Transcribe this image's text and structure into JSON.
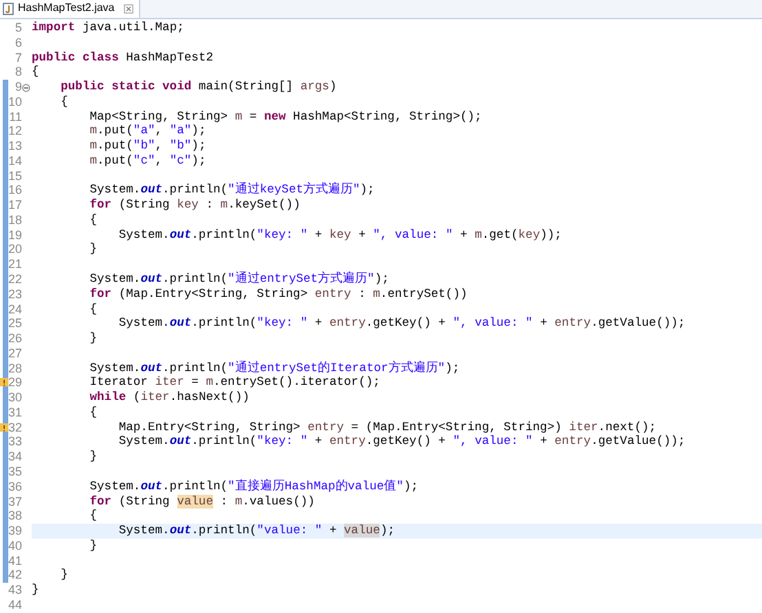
{
  "tab": {
    "title": "HashMapTest2.java",
    "selected": true
  },
  "lines": [
    {
      "number": "5",
      "in_scope": false,
      "current": false,
      "kind": "plain",
      "tokens": [
        {
          "kind": "keyword",
          "text": "import"
        },
        {
          "kind": "plain",
          "text": " java.util.Map;"
        }
      ]
    },
    {
      "number": "6",
      "in_scope": false,
      "current": false,
      "kind": "plain"
    },
    {
      "number": "7",
      "in_scope": false,
      "current": false,
      "kind": "plain",
      "tokens": [
        {
          "kind": "keyword",
          "text": "public "
        },
        {
          "kind": "keyword",
          "text": "class"
        },
        {
          "kind": "plain",
          "text": " HashMapTest2"
        }
      ]
    },
    {
      "number": "8",
      "in_scope": false,
      "current": false,
      "kind": "plain",
      "tokens": [
        {
          "kind": "plain",
          "text": "{"
        }
      ]
    },
    {
      "number": "9",
      "in_scope": true,
      "current": false,
      "kind": "fold",
      "tokens": [
        {
          "kind": "keyword",
          "text": "    public "
        },
        {
          "kind": "keyword",
          "text": "static "
        },
        {
          "kind": "keyword",
          "text": "void"
        },
        {
          "kind": "plain",
          "text": " main(String[] "
        },
        {
          "kind": "variable",
          "text": "args"
        },
        {
          "kind": "plain",
          "text": ")"
        }
      ]
    },
    {
      "number": "10",
      "in_scope": true,
      "current": false,
      "kind": "plain",
      "tokens": [
        {
          "kind": "plain",
          "text": "    {"
        }
      ]
    },
    {
      "number": "11",
      "in_scope": true,
      "current": false,
      "kind": "plain",
      "tokens": [
        {
          "kind": "plain",
          "text": "        Map<String, String> "
        },
        {
          "kind": "variable",
          "text": "m"
        },
        {
          "kind": "plain",
          "text": " = "
        },
        {
          "kind": "keyword",
          "text": "new"
        },
        {
          "kind": "plain",
          "text": " HashMap<String, String>();"
        }
      ]
    },
    {
      "number": "12",
      "in_scope": true,
      "current": false,
      "kind": "plain",
      "tokens": [
        {
          "kind": "variable",
          "text": "        m"
        },
        {
          "kind": "plain",
          "text": ".put("
        },
        {
          "kind": "string",
          "text": "\"a\""
        },
        {
          "kind": "plain",
          "text": ", "
        },
        {
          "kind": "string",
          "text": "\"a\""
        },
        {
          "kind": "plain",
          "text": ");"
        }
      ]
    },
    {
      "number": "13",
      "in_scope": true,
      "current": false,
      "kind": "plain",
      "tokens": [
        {
          "kind": "variable",
          "text": "        m"
        },
        {
          "kind": "plain",
          "text": ".put("
        },
        {
          "kind": "string",
          "text": "\"b\""
        },
        {
          "kind": "plain",
          "text": ", "
        },
        {
          "kind": "string",
          "text": "\"b\""
        },
        {
          "kind": "plain",
          "text": ");"
        }
      ]
    },
    {
      "number": "14",
      "in_scope": true,
      "current": false,
      "kind": "plain",
      "tokens": [
        {
          "kind": "variable",
          "text": "        m"
        },
        {
          "kind": "plain",
          "text": ".put("
        },
        {
          "kind": "string",
          "text": "\"c\""
        },
        {
          "kind": "plain",
          "text": ", "
        },
        {
          "kind": "string",
          "text": "\"c\""
        },
        {
          "kind": "plain",
          "text": ");"
        }
      ]
    },
    {
      "number": "15",
      "in_scope": true,
      "current": false,
      "kind": "plain"
    },
    {
      "number": "16",
      "in_scope": true,
      "current": false,
      "kind": "plain",
      "tokens": [
        {
          "kind": "plain",
          "text": "        System."
        },
        {
          "kind": "field",
          "text": "out"
        },
        {
          "kind": "plain",
          "text": ".println("
        },
        {
          "kind": "string",
          "text": "\"通过keySet方式遍历\""
        },
        {
          "kind": "plain",
          "text": ");"
        }
      ]
    },
    {
      "number": "17",
      "in_scope": true,
      "current": false,
      "kind": "plain",
      "tokens": [
        {
          "kind": "keyword",
          "text": "        for"
        },
        {
          "kind": "plain",
          "text": " (String "
        },
        {
          "kind": "variable",
          "text": "key"
        },
        {
          "kind": "plain",
          "text": " : "
        },
        {
          "kind": "variable",
          "text": "m"
        },
        {
          "kind": "plain",
          "text": ".keySet())"
        }
      ]
    },
    {
      "number": "18",
      "in_scope": true,
      "current": false,
      "kind": "plain",
      "tokens": [
        {
          "kind": "plain",
          "text": "        {"
        }
      ]
    },
    {
      "number": "19",
      "in_scope": true,
      "current": false,
      "kind": "plain",
      "tokens": [
        {
          "kind": "plain",
          "text": "            System."
        },
        {
          "kind": "field",
          "text": "out"
        },
        {
          "kind": "plain",
          "text": ".println("
        },
        {
          "kind": "string",
          "text": "\"key: \""
        },
        {
          "kind": "plain",
          "text": " + "
        },
        {
          "kind": "variable",
          "text": "key"
        },
        {
          "kind": "plain",
          "text": " + "
        },
        {
          "kind": "string",
          "text": "\", value: \""
        },
        {
          "kind": "plain",
          "text": " + "
        },
        {
          "kind": "variable",
          "text": "m"
        },
        {
          "kind": "plain",
          "text": ".get("
        },
        {
          "kind": "variable",
          "text": "key"
        },
        {
          "kind": "plain",
          "text": "));"
        }
      ]
    },
    {
      "number": "20",
      "in_scope": true,
      "current": false,
      "kind": "plain",
      "tokens": [
        {
          "kind": "plain",
          "text": "        }"
        }
      ]
    },
    {
      "number": "21",
      "in_scope": true,
      "current": false,
      "kind": "plain"
    },
    {
      "number": "22",
      "in_scope": true,
      "current": false,
      "kind": "plain",
      "tokens": [
        {
          "kind": "plain",
          "text": "        System."
        },
        {
          "kind": "field",
          "text": "out"
        },
        {
          "kind": "plain",
          "text": ".println("
        },
        {
          "kind": "string",
          "text": "\"通过entrySet方式遍历\""
        },
        {
          "kind": "plain",
          "text": ");"
        }
      ]
    },
    {
      "number": "23",
      "in_scope": true,
      "current": false,
      "kind": "plain",
      "tokens": [
        {
          "kind": "keyword",
          "text": "        for"
        },
        {
          "kind": "plain",
          "text": " (Map.Entry<String, String> "
        },
        {
          "kind": "variable",
          "text": "entry"
        },
        {
          "kind": "plain",
          "text": " : "
        },
        {
          "kind": "variable",
          "text": "m"
        },
        {
          "kind": "plain",
          "text": ".entrySet())"
        }
      ]
    },
    {
      "number": "24",
      "in_scope": true,
      "current": false,
      "kind": "plain",
      "tokens": [
        {
          "kind": "plain",
          "text": "        {"
        }
      ]
    },
    {
      "number": "25",
      "in_scope": true,
      "current": false,
      "kind": "plain",
      "tokens": [
        {
          "kind": "plain",
          "text": "            System."
        },
        {
          "kind": "field",
          "text": "out"
        },
        {
          "kind": "plain",
          "text": ".println("
        },
        {
          "kind": "string",
          "text": "\"key: \""
        },
        {
          "kind": "plain",
          "text": " + "
        },
        {
          "kind": "variable",
          "text": "entry"
        },
        {
          "kind": "plain",
          "text": ".getKey() + "
        },
        {
          "kind": "string",
          "text": "\", value: \""
        },
        {
          "kind": "plain",
          "text": " + "
        },
        {
          "kind": "variable",
          "text": "entry"
        },
        {
          "kind": "plain",
          "text": ".getValue());"
        }
      ]
    },
    {
      "number": "26",
      "in_scope": true,
      "current": false,
      "kind": "plain",
      "tokens": [
        {
          "kind": "plain",
          "text": "        }"
        }
      ]
    },
    {
      "number": "27",
      "in_scope": true,
      "current": false,
      "kind": "plain"
    },
    {
      "number": "28",
      "in_scope": true,
      "current": false,
      "kind": "plain",
      "tokens": [
        {
          "kind": "plain",
          "text": "        System."
        },
        {
          "kind": "field",
          "text": "out"
        },
        {
          "kind": "plain",
          "text": ".println("
        },
        {
          "kind": "string",
          "text": "\"通过entrySet的Iterator方式遍历\""
        },
        {
          "kind": "plain",
          "text": ");"
        }
      ]
    },
    {
      "number": "29",
      "in_scope": true,
      "current": false,
      "kind": "warning",
      "tokens": [
        {
          "kind": "plain",
          "text": "        Iterator "
        },
        {
          "kind": "variable",
          "text": "iter"
        },
        {
          "kind": "plain",
          "text": " = "
        },
        {
          "kind": "variable",
          "text": "m"
        },
        {
          "kind": "plain",
          "text": ".entrySet().iterator();"
        }
      ]
    },
    {
      "number": "30",
      "in_scope": true,
      "current": false,
      "kind": "plain",
      "tokens": [
        {
          "kind": "keyword",
          "text": "        while"
        },
        {
          "kind": "plain",
          "text": " ("
        },
        {
          "kind": "variable",
          "text": "iter"
        },
        {
          "kind": "plain",
          "text": ".hasNext())"
        }
      ]
    },
    {
      "number": "31",
      "in_scope": true,
      "current": false,
      "kind": "plain",
      "tokens": [
        {
          "kind": "plain",
          "text": "        {"
        }
      ]
    },
    {
      "number": "32",
      "in_scope": true,
      "current": false,
      "kind": "warning",
      "tokens": [
        {
          "kind": "plain",
          "text": "            Map.Entry<String, String> "
        },
        {
          "kind": "variable",
          "text": "entry"
        },
        {
          "kind": "plain",
          "text": " = (Map.Entry<String, String>) "
        },
        {
          "kind": "variable",
          "text": "iter"
        },
        {
          "kind": "plain",
          "text": ".next();"
        }
      ]
    },
    {
      "number": "33",
      "in_scope": true,
      "current": false,
      "kind": "plain",
      "tokens": [
        {
          "kind": "plain",
          "text": "            System."
        },
        {
          "kind": "field",
          "text": "out"
        },
        {
          "kind": "plain",
          "text": ".println("
        },
        {
          "kind": "string",
          "text": "\"key: \""
        },
        {
          "kind": "plain",
          "text": " + "
        },
        {
          "kind": "variable",
          "text": "entry"
        },
        {
          "kind": "plain",
          "text": ".getKey() + "
        },
        {
          "kind": "string",
          "text": "\", value: \""
        },
        {
          "kind": "plain",
          "text": " + "
        },
        {
          "kind": "variable",
          "text": "entry"
        },
        {
          "kind": "plain",
          "text": ".getValue());"
        }
      ]
    },
    {
      "number": "34",
      "in_scope": true,
      "current": false,
      "kind": "plain",
      "tokens": [
        {
          "kind": "plain",
          "text": "        }"
        }
      ]
    },
    {
      "number": "35",
      "in_scope": true,
      "current": false,
      "kind": "plain"
    },
    {
      "number": "36",
      "in_scope": true,
      "current": false,
      "kind": "plain",
      "tokens": [
        {
          "kind": "plain",
          "text": "        System."
        },
        {
          "kind": "field",
          "text": "out"
        },
        {
          "kind": "plain",
          "text": ".println("
        },
        {
          "kind": "string",
          "text": "\"直接遍历HashMap的value值\""
        },
        {
          "kind": "plain",
          "text": ");"
        }
      ]
    },
    {
      "number": "37",
      "in_scope": true,
      "current": false,
      "kind": "plain",
      "tokens": [
        {
          "kind": "keyword",
          "text": "        for"
        },
        {
          "kind": "plain",
          "text": " (String "
        },
        {
          "kind": "write_occurrence",
          "text": "value"
        },
        {
          "kind": "plain",
          "text": " : "
        },
        {
          "kind": "variable",
          "text": "m"
        },
        {
          "kind": "plain",
          "text": ".values())"
        }
      ]
    },
    {
      "number": "38",
      "in_scope": true,
      "current": false,
      "kind": "plain",
      "tokens": [
        {
          "kind": "plain",
          "text": "        {"
        }
      ]
    },
    {
      "number": "39",
      "in_scope": true,
      "current": true,
      "kind": "plain",
      "tokens": [
        {
          "kind": "plain",
          "text": "            System."
        },
        {
          "kind": "field",
          "text": "out"
        },
        {
          "kind": "plain",
          "text": ".println("
        },
        {
          "kind": "string",
          "text": "\"value: \""
        },
        {
          "kind": "plain",
          "text": " + "
        },
        {
          "kind": "read_occurrence",
          "text": "value"
        },
        {
          "kind": "plain",
          "text": ");"
        }
      ]
    },
    {
      "number": "40",
      "in_scope": true,
      "current": false,
      "kind": "plain",
      "tokens": [
        {
          "kind": "plain",
          "text": "        }"
        }
      ]
    },
    {
      "number": "41",
      "in_scope": true,
      "current": false,
      "kind": "plain"
    },
    {
      "number": "42",
      "in_scope": true,
      "current": false,
      "kind": "plain",
      "tokens": [
        {
          "kind": "plain",
          "text": "    }"
        }
      ]
    },
    {
      "number": "43",
      "in_scope": false,
      "current": false,
      "kind": "plain",
      "tokens": [
        {
          "kind": "plain",
          "text": "}"
        }
      ]
    },
    {
      "number": "44",
      "in_scope": false,
      "current": false,
      "kind": "plain"
    }
  ]
}
